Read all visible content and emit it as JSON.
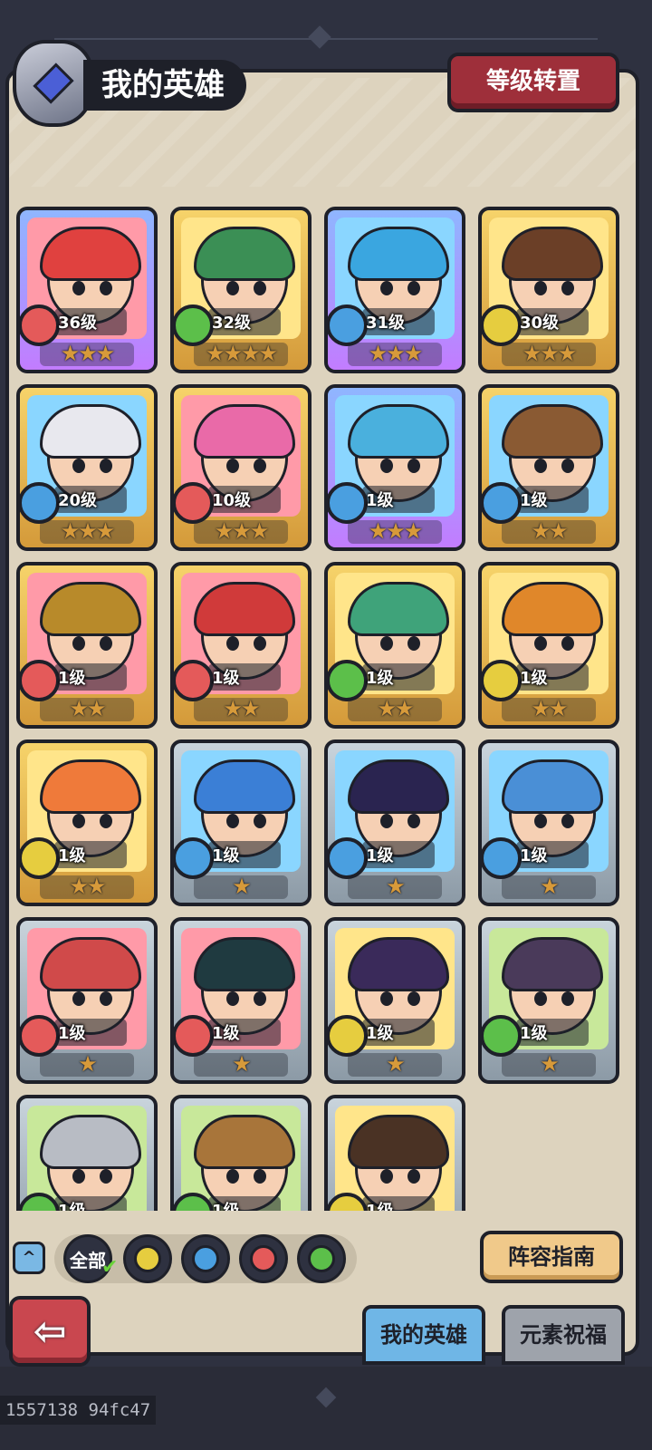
{
  "header": {
    "title": "我的英雄",
    "transfer_button": "等级转置"
  },
  "colors": {
    "fire": "#e45a5a",
    "water": "#4a9fe0",
    "wind": "#5cbf4a",
    "earth": "#e6cd3f"
  },
  "heroes": [
    {
      "level": "36级",
      "stars": "★★★",
      "element": "fire",
      "frame": "purple",
      "bg": "#ff9aa8",
      "hair": "#e0413f"
    },
    {
      "level": "32级",
      "stars": "★★★★",
      "element": "wind",
      "frame": "gold",
      "bg": "#ffe58a",
      "hair": "#3b8f55"
    },
    {
      "level": "31级",
      "stars": "★★★",
      "element": "water",
      "frame": "purple",
      "bg": "#8ad6ff",
      "hair": "#3aa6e0"
    },
    {
      "level": "30级",
      "stars": "★★★",
      "element": "earth",
      "frame": "gold",
      "bg": "#ffe58a",
      "hair": "#6b3f27"
    },
    {
      "level": "20级",
      "stars": "★★★",
      "element": "water",
      "frame": "gold",
      "bg": "#8ad6ff",
      "hair": "#e8e8ee"
    },
    {
      "level": "10级",
      "stars": "★★★",
      "element": "fire",
      "frame": "gold",
      "bg": "#ff9aa8",
      "hair": "#e96aa8"
    },
    {
      "level": "1级",
      "stars": "★★★",
      "element": "water",
      "frame": "purple",
      "bg": "#8ad6ff",
      "hair": "#4ab0dd"
    },
    {
      "level": "1级",
      "stars": "★★",
      "element": "water",
      "frame": "gold",
      "bg": "#8ad6ff",
      "hair": "#8a5a33"
    },
    {
      "level": "1级",
      "stars": "★★",
      "element": "fire",
      "frame": "gold",
      "bg": "#ff9aa8",
      "hair": "#b88a2a"
    },
    {
      "level": "1级",
      "stars": "★★",
      "element": "fire",
      "frame": "gold",
      "bg": "#ff9aa8",
      "hair": "#d03a3a"
    },
    {
      "level": "1级",
      "stars": "★★",
      "element": "wind",
      "frame": "gold",
      "bg": "#ffe58a",
      "hair": "#3fa37a"
    },
    {
      "level": "1级",
      "stars": "★★",
      "element": "earth",
      "frame": "gold",
      "bg": "#ffe58a",
      "hair": "#e0872a"
    },
    {
      "level": "1级",
      "stars": "★★",
      "element": "earth",
      "frame": "gold",
      "bg": "#ffe58a",
      "hair": "#ef7a3a"
    },
    {
      "level": "1级",
      "stars": "★",
      "element": "water",
      "frame": "silver",
      "bg": "#8ad6ff",
      "hair": "#3b7fd6"
    },
    {
      "level": "1级",
      "stars": "★",
      "element": "water",
      "frame": "silver",
      "bg": "#8ad6ff",
      "hair": "#2a2450"
    },
    {
      "level": "1级",
      "stars": "★",
      "element": "water",
      "frame": "silver",
      "bg": "#8ad6ff",
      "hair": "#4a8fd6"
    },
    {
      "level": "1级",
      "stars": "★",
      "element": "fire",
      "frame": "silver",
      "bg": "#ff9aa8",
      "hair": "#d04a4a"
    },
    {
      "level": "1级",
      "stars": "★",
      "element": "fire",
      "frame": "silver",
      "bg": "#ff9aa8",
      "hair": "#1f3a40"
    },
    {
      "level": "1级",
      "stars": "★",
      "element": "earth",
      "frame": "silver",
      "bg": "#ffe58a",
      "hair": "#3a2a5a"
    },
    {
      "level": "1级",
      "stars": "★",
      "element": "wind",
      "frame": "silver",
      "bg": "#c8e89a",
      "hair": "#4a3a5a"
    },
    {
      "level": "1级",
      "stars": "★",
      "element": "wind",
      "frame": "silver",
      "bg": "#c8e89a",
      "hair": "#b8bcc4"
    },
    {
      "level": "1级",
      "stars": "★",
      "element": "wind",
      "frame": "silver",
      "bg": "#c8e89a",
      "hair": "#a8753a"
    },
    {
      "level": "1级",
      "stars": "★",
      "element": "earth",
      "frame": "silver",
      "bg": "#ffe58a",
      "hair": "#4a3224"
    }
  ],
  "filter": {
    "all_label": "全部",
    "scroll_glyph": "^",
    "check_glyph": "✔",
    "elements": [
      "earth",
      "water",
      "fire",
      "wind"
    ]
  },
  "guide_button": "阵容指南",
  "back_glyph": "⇦",
  "tabs": {
    "my_heroes": "我的英雄",
    "blessing": "元素祝福"
  },
  "footer_id": "1557138 94fc47"
}
